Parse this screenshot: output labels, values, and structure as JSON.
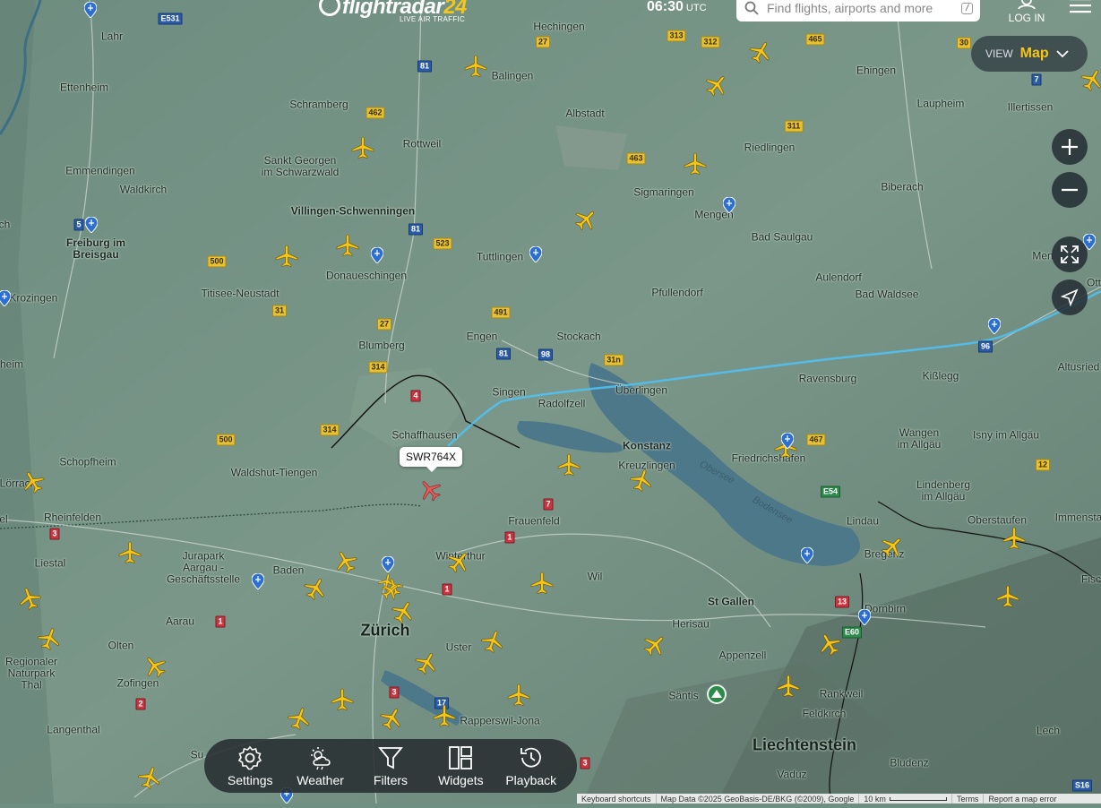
{
  "header": {
    "logo_main": "flightradar",
    "logo_num": "24",
    "logo_sub": "LIVE AIR TRAFFIC",
    "time": "06:30",
    "time_zone": "UTC",
    "search_placeholder": "Find flights, airports and more",
    "search_shortcut": "/",
    "login_label": "LOG IN"
  },
  "view": {
    "label": "VIEW",
    "value": "Map"
  },
  "toolbar": {
    "items": [
      {
        "label": "Settings",
        "icon": "gear-icon"
      },
      {
        "label": "Weather",
        "icon": "weather-icon"
      },
      {
        "label": "Filters",
        "icon": "filter-icon"
      },
      {
        "label": "Widgets",
        "icon": "widgets-icon"
      },
      {
        "label": "Playback",
        "icon": "playback-icon"
      }
    ]
  },
  "selected_flight": {
    "callsign": "SWR764X"
  },
  "attribution": {
    "shortcuts": "Keyboard shortcuts",
    "map_data": "Map Data ©2025 GeoBasis-DE/BKG (©2009), Google",
    "scale": "10 km",
    "terms": "Terms",
    "report": "Report a map error"
  },
  "cities": {
    "lahr": "Lahr",
    "ettenheim": "Ettenheim",
    "emmendingen": "Emmendingen",
    "waldkirch": "Waldkirch",
    "freiburg": "Freiburg im\nBreisgau",
    "krozingen": "ad Krozingen",
    "heim": "heim",
    "schramberg": "Schramberg",
    "rottweil": "Rottweil",
    "stgeorgen": "Sankt Georgen\nim Schwarzwald",
    "villingen": "Villingen-Schwenningen",
    "donaueschingen": "Donaueschingen",
    "titisee": "Titisee-Neustadt",
    "blumberg": "Blumberg",
    "hechingen": "Hechingen",
    "balingen": "Balingen",
    "albstadt": "Albstadt",
    "tuttlingen": "Tuttlingen",
    "sigmaringen": "Sigmaringen",
    "mengen": "Mengen",
    "riedlingen": "Riedlingen",
    "ehingen": "Ehingen",
    "laupheim": "Laupheim",
    "illertissen": "Illertissen",
    "biberach": "Biberach",
    "badsaulgau": "Bad Saulgau",
    "aulendorf": "Aulendorf",
    "badwaldsee": "Bad Waldsee",
    "pfullendorf": "Pfullendorf",
    "engen": "Engen",
    "stockach": "Stockach",
    "singen": "Singen",
    "radolfzell": "Radolfzell",
    "uberlingen": "Überlingen",
    "ravensburg": "Ravensburg",
    "kisslegg": "Kißlegg",
    "altusried": "Altusried",
    "konstanz": "Konstanz",
    "kreuzlingen": "Kreuzlingen",
    "friedrichshafen": "Friedrichshafen",
    "wangen": "Wangen\nim Allgäu",
    "isny": "Isny im Allgäu",
    "lindenberg": "Lindenberg\nim Allgäu",
    "oberstaufen": "Oberstaufen",
    "immenstadt": "Immensta",
    "lindau": "Lindau",
    "bregenz": "Bregenz",
    "dornbirn": "Dornbirn",
    "schaffhausen": "Schaffhausen",
    "schopfheim": "Schopfheim",
    "waldshut": "Waldshut-Tiengen",
    "lorrach": "Lörrach",
    "rheinfelden": "Rheinfelden",
    "liestal": "Liestal",
    "jurapark": "Jurapark\nAargau -\nGeschäftsstelle",
    "baden": "Baden",
    "aarau": "Aarau",
    "olten": "Olten",
    "zofingen": "Zofingen",
    "regionaler": "Regionaler\nNaturpark\nThal",
    "langenthal": "Langenthal",
    "zurich": "Zürich",
    "winterthur": "Winterthur",
    "frauenfeld": "Frauenfeld",
    "wil": "Wil",
    "stgallen": "St Gallen",
    "herisau": "Herisau",
    "appenzell": "Appenzell",
    "uster": "Uster",
    "rapperswil": "Rapperswil-Jona",
    "santis": "Säntis",
    "rankweil": "Rankweil",
    "feldkirch": "Feldkirch",
    "liechtenstein": "Liechtenstein",
    "vaduz": "Vaduz",
    "bludenz": "Bludenz",
    "lech": "Lech",
    "fisc": "Fisc",
    "ottob": "Ott",
    "men": "Men",
    "ch": "ch",
    "su": "Su",
    "el": "el",
    "obersee": "Obersee",
    "bodensee": "Bodensee"
  },
  "roads": [
    "E531",
    "81",
    "27",
    "313",
    "312",
    "465",
    "30",
    "7",
    "462",
    "311",
    "463",
    "5",
    "81",
    "523",
    "500",
    "31",
    "27",
    "491",
    "81",
    "98",
    "31n",
    "314",
    "4",
    "314",
    "500",
    "7",
    "467",
    "E54",
    "12",
    "3",
    "1",
    "1",
    "1",
    "3",
    "2",
    "17",
    "13",
    "E60",
    "3",
    "S16",
    "96"
  ],
  "colors": {
    "accent": "#f5c518",
    "plane": "#f5c518",
    "selected_plane": "#e85a5a",
    "track": "#4fc3f7"
  }
}
